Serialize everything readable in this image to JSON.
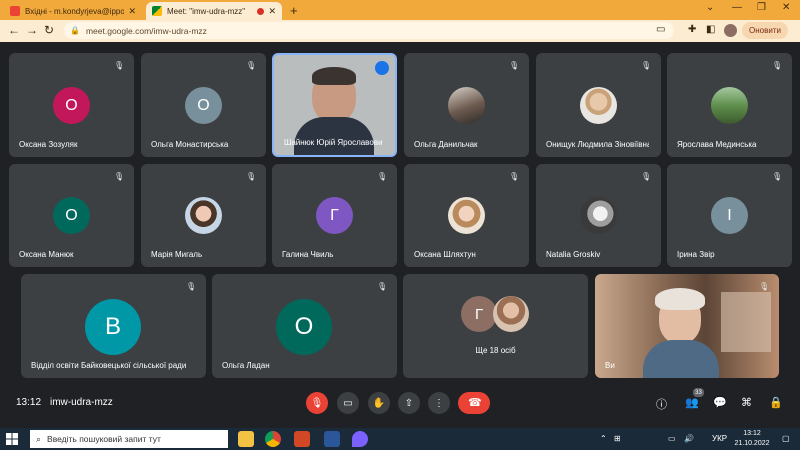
{
  "browser": {
    "tabs": [
      {
        "label": "Вхідні - m.kondyrjeva@ippo.edu"
      },
      {
        "label": "Meet: \"imw-udra-mzz\""
      }
    ],
    "url": "meet.google.com/imw-udra-mzz",
    "update_label": "Оновити"
  },
  "participants": [
    {
      "name": "Оксана Зозуляк",
      "initial": "О",
      "color": "#c2185b"
    },
    {
      "name": "Ольга Монастирська",
      "initial": "О",
      "color": "#78909c"
    },
    {
      "name": "Шайнюк Юрій Ярославович",
      "initial": "",
      "color": ""
    },
    {
      "name": "Ольга Данильчак",
      "initial": "",
      "color": ""
    },
    {
      "name": "Онищук Людмила Зіновіївна",
      "initial": "",
      "color": ""
    },
    {
      "name": "Ярослава Мединська",
      "initial": "",
      "color": ""
    },
    {
      "name": "Оксана Манюк",
      "initial": "О",
      "color": "#00695c"
    },
    {
      "name": "Марія Мигаль",
      "initial": "",
      "color": ""
    },
    {
      "name": "Галина Чвиль",
      "initial": "Г",
      "color": "#7e57c2"
    },
    {
      "name": "Оксана Шляхтун",
      "initial": "",
      "color": ""
    },
    {
      "name": "Natalia Groskiv",
      "initial": "",
      "color": ""
    },
    {
      "name": "Ірина Звір",
      "initial": "І",
      "color": "#78909c"
    },
    {
      "name": "Відділ освіти Байковецької сільської ради",
      "initial": "В",
      "color": "#0097a7"
    },
    {
      "name": "Ольга Ладан",
      "initial": "О",
      "color": "#00695c"
    },
    {
      "name": "Ще 18 осіб",
      "initial": "Г",
      "color": "#8d6e63"
    },
    {
      "name": "Ви",
      "initial": "",
      "color": ""
    }
  ],
  "meeting": {
    "time": "13:12",
    "code": "imw-udra-mzz",
    "people_count": "33"
  },
  "taskbar": {
    "search_placeholder": "Введіть пошуковий запит тут",
    "lang": "УКР",
    "time": "13:12",
    "date": "21.10.2022"
  }
}
